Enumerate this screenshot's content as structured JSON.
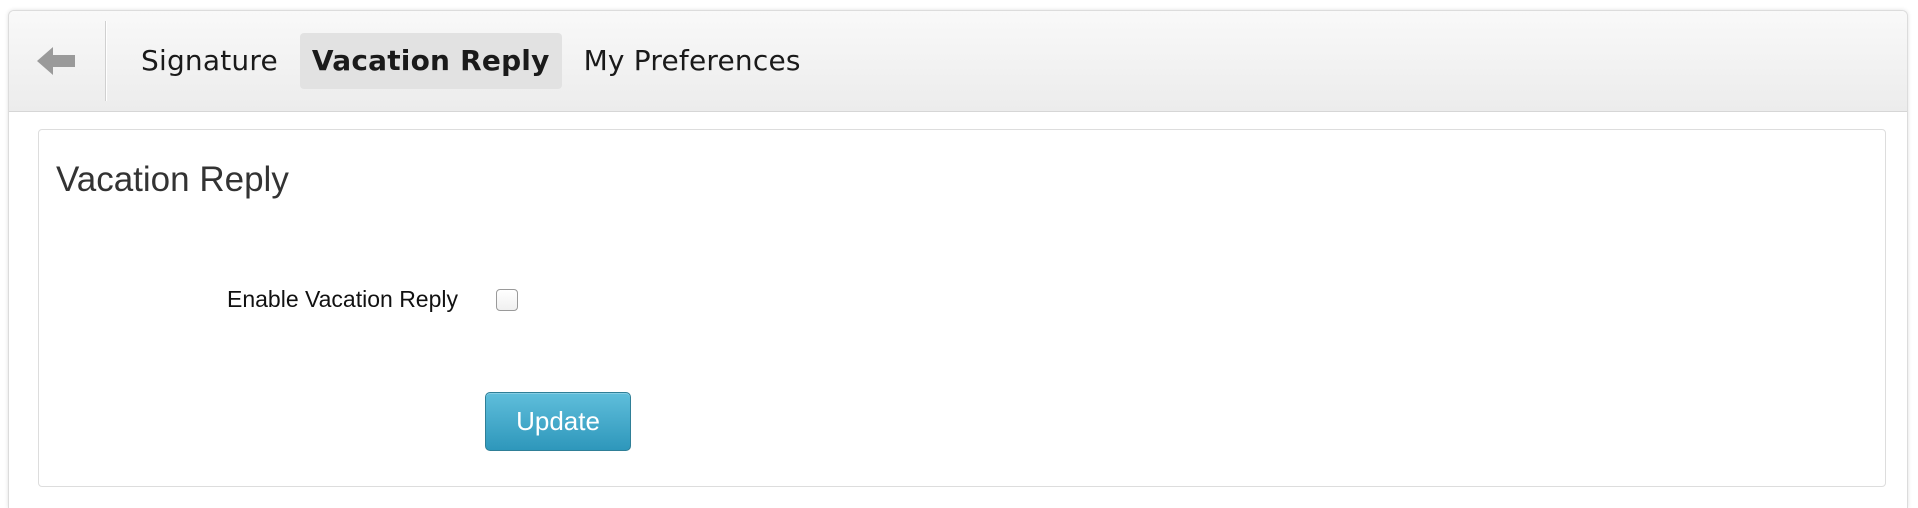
{
  "toolbar": {
    "back_icon": "arrow-left-icon",
    "tabs": [
      {
        "label": "Signature",
        "active": false
      },
      {
        "label": "Vacation Reply",
        "active": true
      },
      {
        "label": "My Preferences",
        "active": false
      }
    ]
  },
  "main": {
    "title": "Vacation Reply",
    "enable_label": "Enable Vacation Reply",
    "enable_checked": false,
    "update_label": "Update"
  },
  "colors": {
    "accent": "#3aa3c6",
    "active_tab_bg": "#e2e2e2"
  }
}
